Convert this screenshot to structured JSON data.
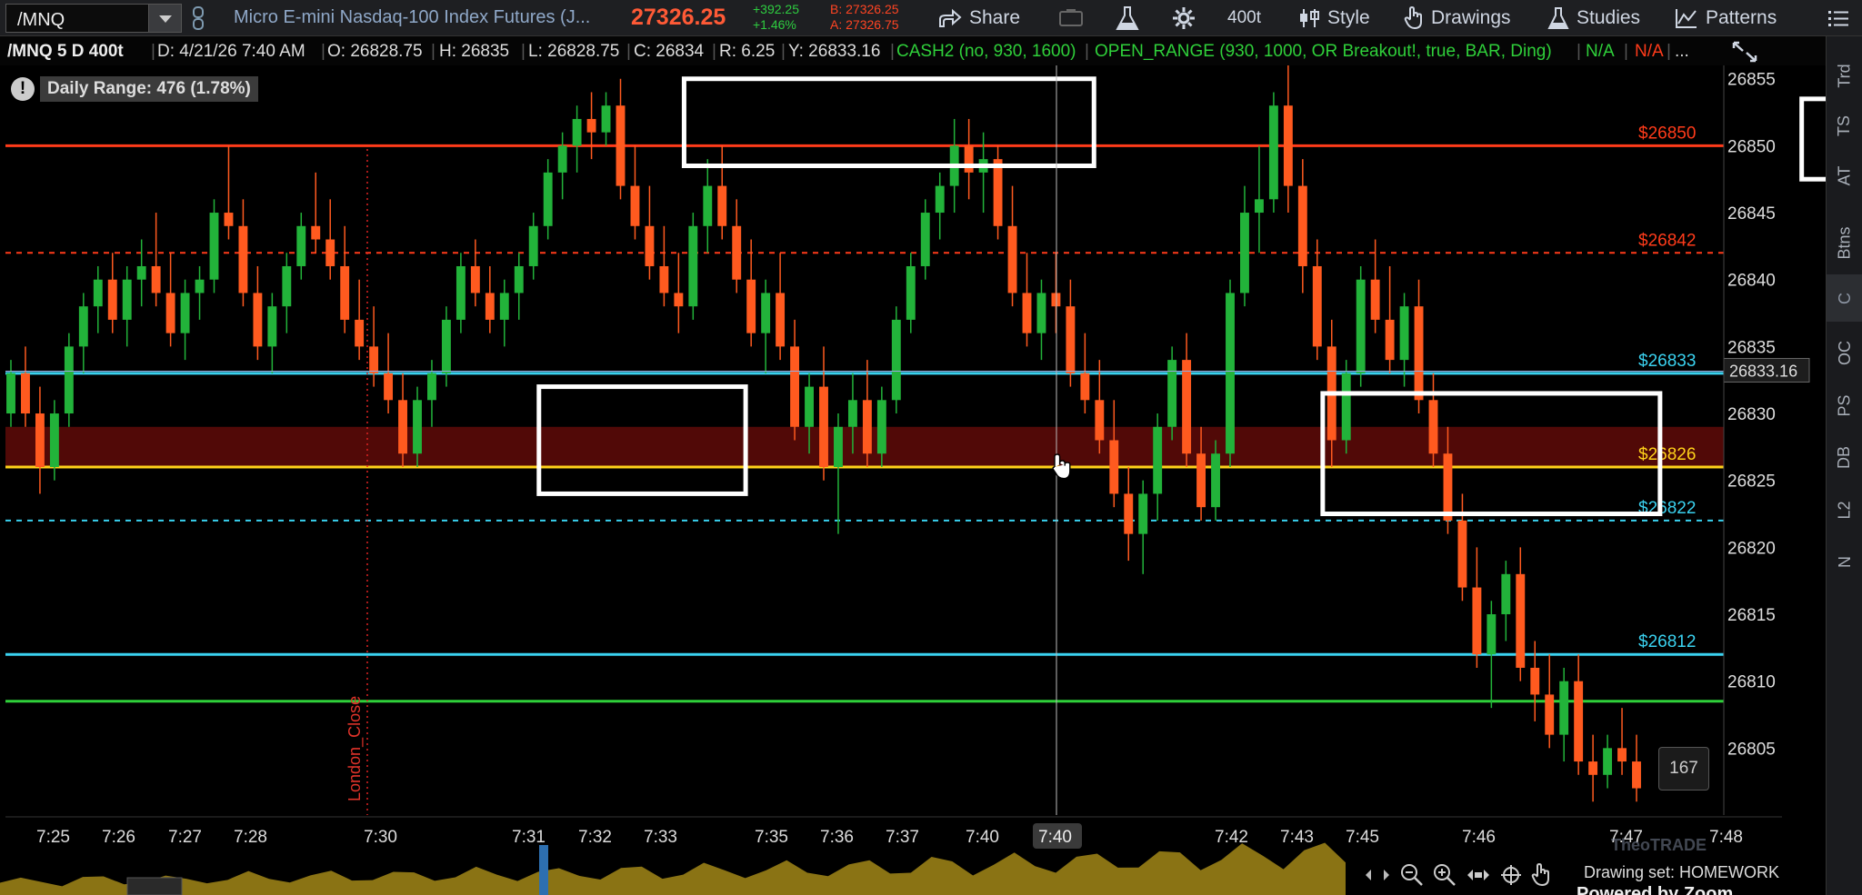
{
  "toolbar": {
    "symbol": "/MNQ",
    "description": "Micro E-mini Nasdaq-100 Index Futures (J...",
    "last_price": "27326.25",
    "change": "+392.25",
    "change_pct": "+1.46%",
    "bid": "B: 27326.25",
    "ask": "A: 27326.75",
    "share_label": "Share",
    "aggregation": "400t",
    "style_label": "Style",
    "drawings_label": "Drawings",
    "studies_label": "Studies",
    "patterns_label": "Patterns"
  },
  "info": {
    "chart_id": "/MNQ 5 D 400t",
    "date": "D: 4/21/26 7:40 AM",
    "open": "O: 26828.75",
    "high": "H: 26835",
    "low": "L: 26828.75",
    "close": "C: 26834",
    "range": "R: 6.25",
    "y": "Y: 26833.16",
    "study1": "CASH2 (no, 930, 1600)",
    "study2": "OPEN_RANGE (930, 1000, OR Breakout!, true, BAR, Ding)",
    "na1": "N/A",
    "na2": "N/A",
    "more": "..."
  },
  "overlay": {
    "daily_range": "Daily Range: 476 (1.78%)",
    "count": "167",
    "drawing_set": "Drawing set: HOMEWORK",
    "powered_by": "Powered by Zoom",
    "watermark": "TheoTRADE"
  },
  "right_tabs": [
    "Trd",
    "TS",
    "AT",
    "Btns",
    "C",
    "OC",
    "PS",
    "DB",
    "L2",
    "N"
  ],
  "colors": {
    "up": "#22b33a",
    "down": "#ff5a1f",
    "level_red": "#ff3b1a",
    "level_cyan": "#3ad2f0",
    "level_yellow": "#ffd21a",
    "level_green": "#2fd03a",
    "zone": "#5a0a08",
    "volume": "#8a7314"
  },
  "chart_data": {
    "type": "candlestick",
    "ylim": [
      26800,
      26856
    ],
    "y_ticks": [
      26805,
      26810,
      26815,
      26820,
      26825,
      26830,
      26835,
      26840,
      26845,
      26850,
      26855
    ],
    "x_ticks": [
      "7:25",
      "7:26",
      "7:27",
      "7:28",
      "7:30",
      "7:31",
      "7:32",
      "7:33",
      "7:35",
      "7:36",
      "7:37",
      "7:40",
      "7:42",
      "7:43",
      "7:45",
      "7:46",
      "7:47",
      "7:48"
    ],
    "crosshair_time": "7:40",
    "crosshair_price": "26833.16",
    "vertical_marker": "London_Close",
    "levels": [
      {
        "price": 26850,
        "label": "$26850",
        "color": "#ff3b1a",
        "style": "solid"
      },
      {
        "price": 26842,
        "label": "$26842",
        "color": "#ff3b1a",
        "style": "dashed"
      },
      {
        "price": 26833,
        "label": "$26833",
        "color": "#3ad2f0",
        "style": "solid"
      },
      {
        "price": 26826,
        "label": "$26826",
        "color": "#ffd21a",
        "style": "solid"
      },
      {
        "price": 26822,
        "label": "$26822",
        "color": "#3ad2f0",
        "style": "dashed"
      },
      {
        "price": 26812,
        "label": "$26812",
        "color": "#3ad2f0",
        "style": "solid"
      },
      {
        "price": 26808.5,
        "label": "",
        "color": "#2fd03a",
        "style": "solid"
      }
    ],
    "zone": [
      26826,
      26829
    ],
    "boxes": [
      {
        "bar_from": 47,
        "bar_to": 74,
        "price_top": 26855,
        "price_bottom": 26848.5
      },
      {
        "bar_from": 124,
        "bar_to": 143,
        "price_top": 26853.5,
        "price_bottom": 26847.5
      },
      {
        "bar_from": 37,
        "bar_to": 50,
        "price_top": 26832,
        "price_bottom": 26824
      },
      {
        "bar_from": 91,
        "bar_to": 113,
        "price_top": 26831.5,
        "price_bottom": 26822.5
      }
    ],
    "candles": [
      [
        26830,
        26834,
        26829,
        26833
      ],
      [
        26833,
        26835,
        26829,
        26830
      ],
      [
        26830,
        26832,
        26824,
        26826
      ],
      [
        26826,
        26831,
        26825,
        26830
      ],
      [
        26830,
        26836,
        26829,
        26835
      ],
      [
        26835,
        26839,
        26833,
        26838
      ],
      [
        26838,
        26841,
        26836,
        26840
      ],
      [
        26840,
        26842,
        26836,
        26837
      ],
      [
        26837,
        26841,
        26835,
        26840
      ],
      [
        26840,
        26843,
        26838,
        26841
      ],
      [
        26841,
        26845,
        26838,
        26839
      ],
      [
        26839,
        26842,
        26835,
        26836
      ],
      [
        26836,
        26840,
        26834,
        26839
      ],
      [
        26839,
        26841,
        26837,
        26840
      ],
      [
        26840,
        26846,
        26839,
        26845
      ],
      [
        26845,
        26850,
        26843,
        26844
      ],
      [
        26844,
        26846,
        26838,
        26839
      ],
      [
        26839,
        26841,
        26834,
        26835
      ],
      [
        26835,
        26839,
        26833,
        26838
      ],
      [
        26838,
        26842,
        26836,
        26841
      ],
      [
        26841,
        26845,
        26840,
        26844
      ],
      [
        26844,
        26848,
        26842,
        26843
      ],
      [
        26843,
        26846,
        26840,
        26841
      ],
      [
        26841,
        26844,
        26836,
        26837
      ],
      [
        26837,
        26840,
        26834,
        26835
      ],
      [
        26835,
        26838,
        26832,
        26833
      ],
      [
        26833,
        26836,
        26830,
        26831
      ],
      [
        26831,
        26833,
        26826,
        26827
      ],
      [
        26827,
        26832,
        26826,
        26831
      ],
      [
        26831,
        26834,
        26829,
        26833
      ],
      [
        26833,
        26838,
        26832,
        26837
      ],
      [
        26837,
        26842,
        26836,
        26841
      ],
      [
        26841,
        26843,
        26838,
        26839
      ],
      [
        26839,
        26841,
        26836,
        26837
      ],
      [
        26837,
        26840,
        26835,
        26839
      ],
      [
        26839,
        26842,
        26837,
        26841
      ],
      [
        26841,
        26845,
        26840,
        26844
      ],
      [
        26844,
        26849,
        26843,
        26848
      ],
      [
        26848,
        26851,
        26846,
        26850
      ],
      [
        26850,
        26853,
        26848,
        26852
      ],
      [
        26852,
        26854,
        26849,
        26851
      ],
      [
        26851,
        26854,
        26850,
        26853
      ],
      [
        26853,
        26855,
        26846,
        26847
      ],
      [
        26847,
        26850,
        26843,
        26844
      ],
      [
        26844,
        26847,
        26840,
        26841
      ],
      [
        26841,
        26844,
        26838,
        26839
      ],
      [
        26839,
        26842,
        26836,
        26838
      ],
      [
        26838,
        26845,
        26837,
        26844
      ],
      [
        26844,
        26849,
        26842,
        26847
      ],
      [
        26847,
        26850,
        26843,
        26844
      ],
      [
        26844,
        26846,
        26839,
        26840
      ],
      [
        26840,
        26843,
        26835,
        26836
      ],
      [
        26836,
        26840,
        26833,
        26839
      ],
      [
        26839,
        26842,
        26834,
        26835
      ],
      [
        26835,
        26837,
        26828,
        26829
      ],
      [
        26829,
        26833,
        26827,
        26832
      ],
      [
        26832,
        26835,
        26825,
        26826
      ],
      [
        26826,
        26830,
        26821,
        26829
      ],
      [
        26829,
        26833,
        26827,
        26831
      ],
      [
        26831,
        26834,
        26826,
        26827
      ],
      [
        26827,
        26832,
        26826,
        26831
      ],
      [
        26831,
        26838,
        26830,
        26837
      ],
      [
        26837,
        26842,
        26836,
        26841
      ],
      [
        26841,
        26846,
        26840,
        26845
      ],
      [
        26845,
        26848,
        26843,
        26847
      ],
      [
        26847,
        26852,
        26845,
        26850
      ],
      [
        26850,
        26852,
        26846,
        26848
      ],
      [
        26848,
        26851,
        26845,
        26849
      ],
      [
        26849,
        26850,
        26843,
        26844
      ],
      [
        26844,
        26847,
        26838,
        26839
      ],
      [
        26839,
        26842,
        26835,
        26836
      ],
      [
        26836,
        26840,
        26834,
        26839
      ],
      [
        26839,
        26842,
        26836,
        26838
      ],
      [
        26838,
        26840,
        26832,
        26833
      ],
      [
        26833,
        26836,
        26830,
        26831
      ],
      [
        26831,
        26834,
        26827,
        26828
      ],
      [
        26828,
        26831,
        26823,
        26824
      ],
      [
        26824,
        26826,
        26819,
        26821
      ],
      [
        26821,
        26825,
        26818,
        26824
      ],
      [
        26824,
        26830,
        26822,
        26829
      ],
      [
        26829,
        26835,
        26828,
        26834
      ],
      [
        26834,
        26836,
        26826,
        26827
      ],
      [
        26827,
        26829,
        26822,
        26823
      ],
      [
        26823,
        26828,
        26822,
        26827
      ],
      [
        26827,
        26840,
        26826,
        26839
      ],
      [
        26839,
        26847,
        26838,
        26845
      ],
      [
        26845,
        26850,
        26842,
        26846
      ],
      [
        26846,
        26854,
        26845,
        26853
      ],
      [
        26853,
        26856,
        26845,
        26847
      ],
      [
        26847,
        26849,
        26839,
        26841
      ],
      [
        26841,
        26843,
        26834,
        26835
      ],
      [
        26835,
        26837,
        26826,
        26828
      ],
      [
        26828,
        26834,
        26827,
        26833
      ],
      [
        26833,
        26841,
        26832,
        26840
      ],
      [
        26840,
        26843,
        26836,
        26837
      ],
      [
        26837,
        26841,
        26833,
        26834
      ],
      [
        26834,
        26839,
        26832,
        26838
      ],
      [
        26838,
        26840,
        26830,
        26831
      ],
      [
        26831,
        26833,
        26826,
        26827
      ],
      [
        26827,
        26829,
        26821,
        26822
      ],
      [
        26822,
        26824,
        26816,
        26817
      ],
      [
        26817,
        26820,
        26811,
        26812
      ],
      [
        26812,
        26816,
        26808,
        26815
      ],
      [
        26815,
        26819,
        26813,
        26818
      ],
      [
        26818,
        26820,
        26810,
        26811
      ],
      [
        26811,
        26813,
        26807,
        26809
      ],
      [
        26809,
        26812,
        26805,
        26806
      ],
      [
        26806,
        26811,
        26804,
        26810
      ],
      [
        26810,
        26812,
        26803,
        26804
      ],
      [
        26804,
        26806,
        26801,
        26803
      ],
      [
        26803,
        26806,
        26802,
        26805
      ],
      [
        26805,
        26808,
        26803,
        26804
      ],
      [
        26804,
        26806,
        26801,
        26802
      ]
    ],
    "volume": [
      0.3,
      0.32,
      0.35,
      0.31,
      0.38,
      0.36,
      0.34,
      0.4,
      0.37,
      0.35,
      0.42,
      0.39,
      0.44,
      0.41,
      0.45,
      0.43,
      0.46,
      0.44,
      0.48,
      0.45,
      0.47,
      0.5,
      0.48,
      0.52,
      0.49,
      0.51,
      0.53,
      0.5,
      0.55,
      0.52,
      0.54,
      0.57,
      0.55,
      0.58,
      0.6,
      0.57,
      0.62,
      0.59,
      0.64,
      0.61,
      0.66,
      0.63,
      0.68,
      0.7,
      0.67,
      0.72,
      0.74,
      0.71,
      0.76,
      0.78,
      0.75,
      0.8,
      0.82,
      0.79,
      0.85,
      0.87,
      0.84,
      0.9,
      0.88,
      0.93,
      0.95,
      0.97,
      0.94,
      1.0,
      0.98,
      0.96
    ]
  }
}
